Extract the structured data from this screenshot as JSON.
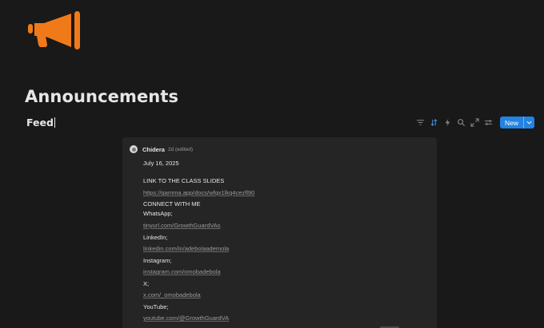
{
  "page": {
    "icon": "megaphone-icon",
    "title": "Announcements",
    "view_tab": "Feed"
  },
  "colors": {
    "background": "#191919",
    "card": "#252525",
    "icon": "#f07a1a",
    "accent": "#2383e2"
  },
  "toolbar": {
    "icons": [
      "filter-icon",
      "sort-icon",
      "lightning-icon",
      "search-icon",
      "expand-icon",
      "settings-icon"
    ],
    "new_label": "New"
  },
  "post": {
    "author": "Chidera",
    "meta": "2d (edited)",
    "lines": [
      {
        "text": "July 16, 2025",
        "kind": "text"
      },
      {
        "text": "LINK TO THE CLASS SLIDES",
        "kind": "text"
      },
      {
        "text": "https://gamma.app/docs/wfqx1lkq4cezfl90",
        "kind": "link"
      },
      {
        "text": "CONNECT WITH ME",
        "kind": "text"
      },
      {
        "text": "WhatsApp;",
        "kind": "text"
      },
      {
        "text": "tinyurl.com/GrowthGuardVAs",
        "kind": "link"
      },
      {
        "text": "LinkedIn;",
        "kind": "text"
      },
      {
        "text": "linkedin.com/in/adebolaademola",
        "kind": "link"
      },
      {
        "text": "Instagram;",
        "kind": "text"
      },
      {
        "text": "instagram.com/omobadebola",
        "kind": "link"
      },
      {
        "text": "X;",
        "kind": "text"
      },
      {
        "text": "x.com/_omobadebola",
        "kind": "link"
      },
      {
        "text": "YouTube;",
        "kind": "text"
      },
      {
        "text": "youtube.com/@GrowthGuardVA",
        "kind": "link"
      }
    ]
  }
}
